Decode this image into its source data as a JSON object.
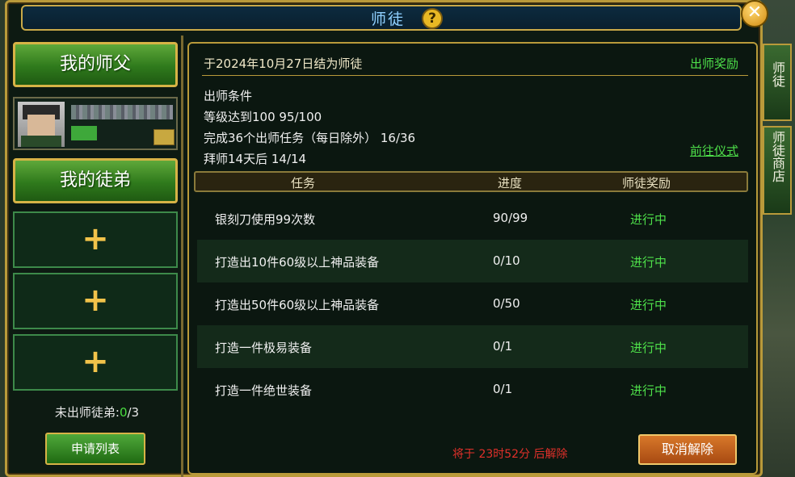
{
  "window": {
    "title": "师徒",
    "help": "?",
    "close": "✕"
  },
  "left": {
    "master_btn": "我的师父",
    "apprentice_btn": "我的徒弟",
    "slots": [
      "+",
      "+",
      "+"
    ],
    "count_label": "未出师徒弟:",
    "count_current": "0",
    "count_total": "/3",
    "apply_btn": "申请列表"
  },
  "content": {
    "date_line": "于2024年10月27日结为师徒",
    "reward_link": "出师奖励",
    "conditions": {
      "heading": "出师条件",
      "level": "等级达到100   95/100",
      "tasks": "完成36个出师任务（每日除外）   16/36",
      "days": "拜师14天后   14/14"
    },
    "go_link": "前往仪式",
    "headers": {
      "task": "任务",
      "progress": "进度",
      "reward": "师徒奖励"
    },
    "rows": [
      {
        "task": "银刻刀使用99次数",
        "progress": "90/99",
        "status": "进行中"
      },
      {
        "task": "打造出10件60级以上神品装备",
        "progress": "0/10",
        "status": "进行中"
      },
      {
        "task": "打造出50件60级以上神品装备",
        "progress": "0/50",
        "status": "进行中"
      },
      {
        "task": "打造一件极易装备",
        "progress": "0/1",
        "status": "进行中"
      },
      {
        "task": "打造一件绝世装备",
        "progress": "0/1",
        "status": "进行中"
      }
    ],
    "timer": "将于 23时52分 后解除",
    "cancel_btn": "取消解除"
  },
  "side_tabs": [
    "师徒",
    "师徒商店"
  ]
}
